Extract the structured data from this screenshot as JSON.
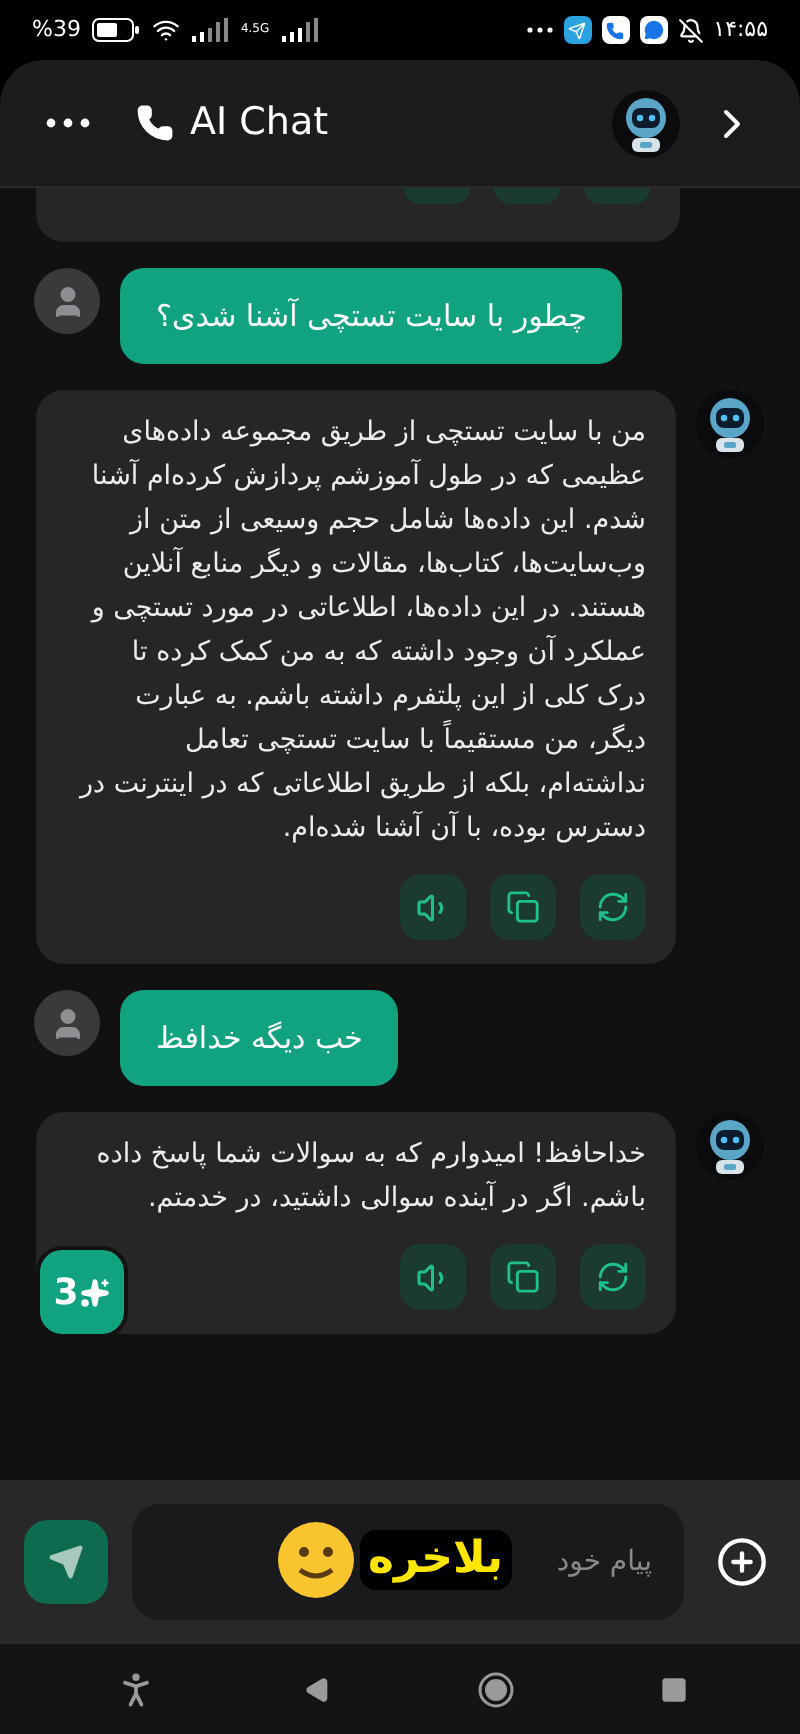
{
  "status_bar": {
    "battery": "%39",
    "network": "4.5G",
    "time": "۱۴:۵۵"
  },
  "header": {
    "title": "AI Chat"
  },
  "messages": [
    {
      "kind": "user",
      "text": "چطور با سایت تستچی آشنا شدی؟"
    },
    {
      "kind": "bot",
      "text": "من با سایت تستچی از طریق مجموعه داده‌های عظیمی که در طول آموزشم پردازش کرده‌ام آشنا شدم. این داده‌ها شامل حجم وسیعی از متن از وب‌سایت‌ها، کتاب‌ها، مقالات و دیگر منابع آنلاین هستند.  در این داده‌ها، اطلاعاتی در مورد تستچی و عملکرد آن وجود داشته که به من کمک کرده تا درک کلی از این پلتفرم داشته باشم.  به عبارت دیگر، من مستقیماً با سایت تستچی تعامل نداشته‌ام، بلکه از طریق اطلاعاتی که در اینترنت در دسترس بوده، با آن آشنا شده‌ام."
    },
    {
      "kind": "user",
      "text": "خب دیگه خدافظ"
    },
    {
      "kind": "bot",
      "text": "خداحافظ!  امیدوارم که به سوالات شما پاسخ داده باشم.  اگر در آینده سوالی داشتید، در خدمتم."
    }
  ],
  "credits_badge": {
    "count": "3"
  },
  "composer": {
    "placeholder": "پیام خود"
  },
  "sticker": {
    "text": "بلاخره"
  }
}
